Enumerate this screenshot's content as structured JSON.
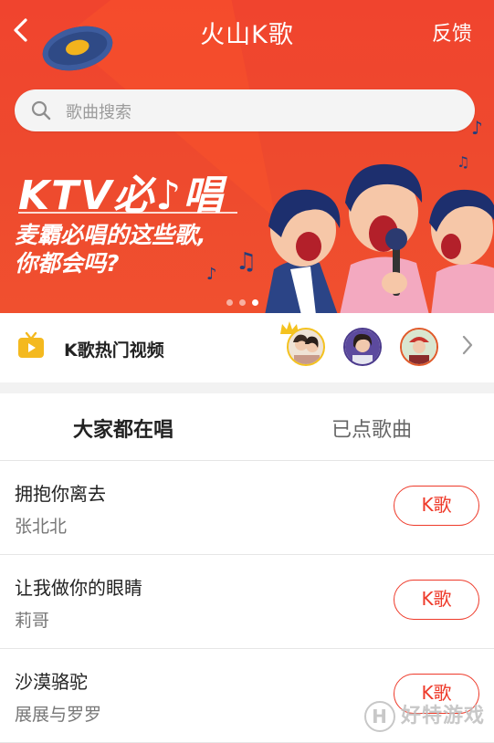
{
  "header": {
    "back_icon": "back-chevron-icon",
    "title": "火山K歌",
    "feedback": "反馈"
  },
  "search": {
    "placeholder": "歌曲搜索",
    "icon": "search-icon"
  },
  "banner": {
    "headline": "KTV必♪唱",
    "slogan_line1": "麦霸必唱的这些歌,",
    "slogan_line2": "你都会吗?",
    "carousel_pages": 3,
    "carousel_active": 3
  },
  "hot_videos": {
    "icon": "tv-icon",
    "label": "K歌热门视频",
    "avatars": [
      "avatar-1",
      "avatar-2",
      "avatar-3"
    ],
    "more_icon": "chevron-right-icon"
  },
  "tabs": {
    "active": "大家都在唱",
    "inactive": "已点歌曲"
  },
  "songs": [
    {
      "name": "拥抱你离去",
      "artist": "张北北",
      "button": "K歌"
    },
    {
      "name": "让我做你的眼睛",
      "artist": "莉哥",
      "button": "K歌"
    },
    {
      "name": "沙漠骆驼",
      "artist": "展展与罗罗",
      "button": "K歌"
    }
  ],
  "watermark": {
    "text": "好特游戏",
    "badge": "H"
  },
  "colors": {
    "accent": "#ee3a2a",
    "banner_red": "#f0442e",
    "text_primary": "#222222",
    "text_secondary": "#777777"
  }
}
